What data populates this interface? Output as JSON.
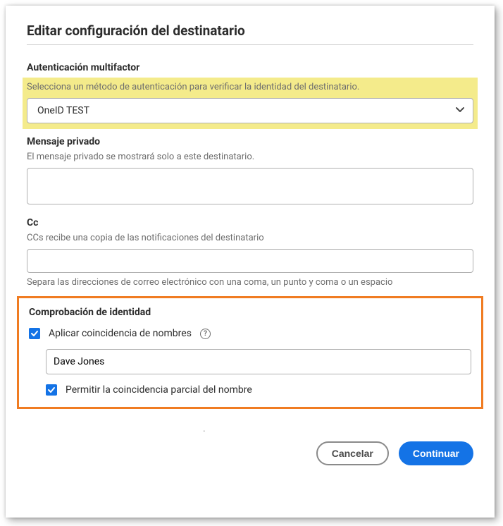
{
  "dialog": {
    "title": "Editar configuración del destinatario"
  },
  "mfa": {
    "label": "Autenticación multifactor",
    "helper": "Selecciona un método de autenticación para verificar la identidad del destinatario.",
    "selected": "OneID TEST"
  },
  "privateMessage": {
    "label": "Mensaje privado",
    "helper": "El mensaje privado se mostrará solo a este destinatario.",
    "value": ""
  },
  "cc": {
    "label": "Cc",
    "helper": "CCs recibe una copia de las notificaciones del destinatario",
    "value": "",
    "footerHelper": "Separa las direcciones de correo electrónico con una coma, un punto y coma o un espacio"
  },
  "identity": {
    "label": "Comprobación de identidad",
    "enforceNameMatch": {
      "checked": true,
      "label": "Aplicar coincidencia de nombres"
    },
    "nameValue": "Dave Jones",
    "allowPartial": {
      "checked": true,
      "label": "Permitir la coincidencia parcial del nombre"
    }
  },
  "actions": {
    "cancel": "Cancelar",
    "continue": "Continuar"
  },
  "misc": {
    "dot": "."
  }
}
